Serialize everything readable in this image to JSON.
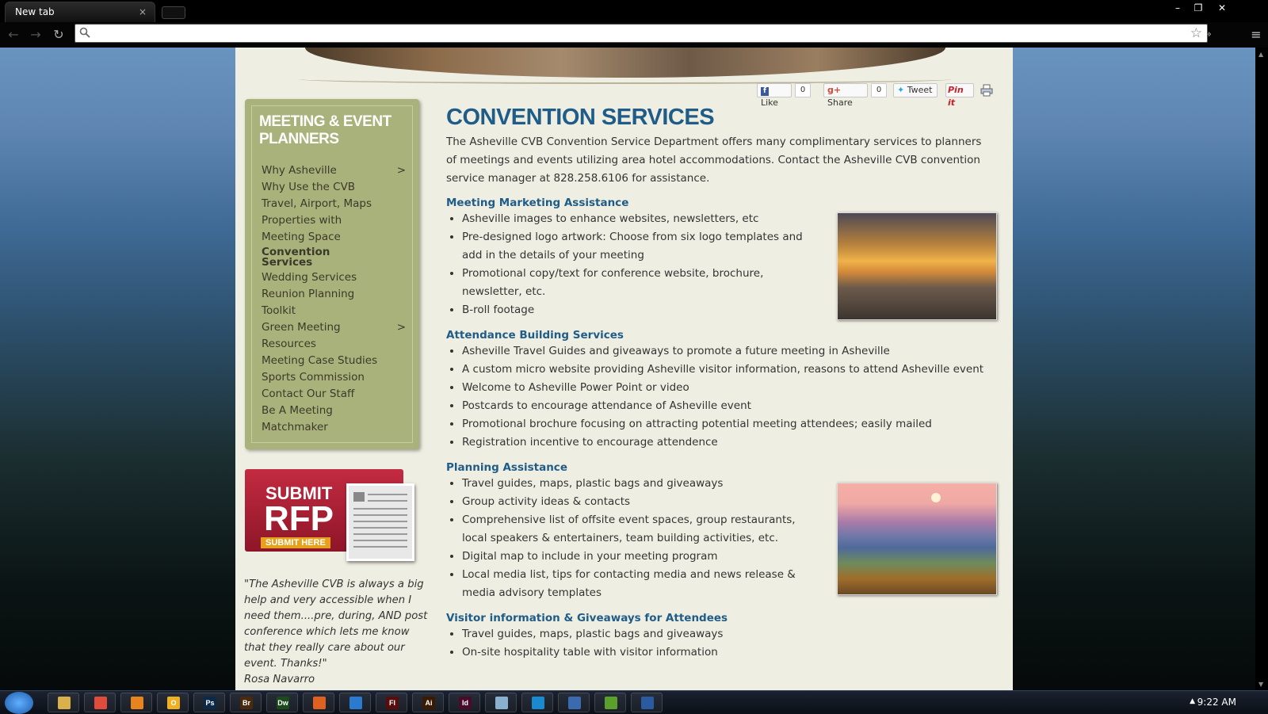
{
  "browser": {
    "tab_title": "New tab",
    "tab_close": "×",
    "address_value": "",
    "menu_glyph": "≡",
    "more_glyph": "»",
    "star_glyph": "☆",
    "win_min": "–",
    "win_max": "❐",
    "win_close": "✕"
  },
  "social": {
    "like_label": "Like",
    "like_count": "0",
    "share_label": "Share",
    "share_count": "0",
    "tweet_label": "Tweet",
    "pin_label": "Pin it"
  },
  "sidebar": {
    "title": "MEETING & EVENT PLANNERS",
    "items": [
      {
        "label": "Why Asheville",
        "arrow": ">"
      },
      {
        "label": "Why Use the CVB",
        "arrow": ""
      },
      {
        "label": "Travel, Airport, Maps",
        "arrow": ""
      },
      {
        "label": "Properties with Meeting Space",
        "arrow": ""
      },
      {
        "label": "Convention Services",
        "arrow": ""
      },
      {
        "label": "Wedding Services",
        "arrow": ""
      },
      {
        "label": "Reunion Planning",
        "arrow": ""
      },
      {
        "label": "Toolkit",
        "arrow": ""
      },
      {
        "label": "Green Meeting Resources",
        "arrow": ">"
      },
      {
        "label": "Meeting Case Studies",
        "arrow": ""
      },
      {
        "label": "Sports Commission",
        "arrow": ""
      },
      {
        "label": "Contact Our Staff",
        "arrow": ""
      },
      {
        "label": "Be A Meeting Matchmaker",
        "arrow": ""
      }
    ]
  },
  "rfp": {
    "submit": "SUBMIT",
    "rfp": "RFP",
    "submit_here": "SUBMIT HERE"
  },
  "testimonial": {
    "quote": "\"The Asheville CVB is always a big help and very accessible when I need them....pre, during, AND post conference which lets me know that they really care about our event. Thanks!\"",
    "author": "Rosa Navarro"
  },
  "main": {
    "title": "CONVENTION SERVICES",
    "intro": "The Asheville CVB Convention Service Department offers many complimentary services to planners of meetings and events utilizing area hotel accommodations. Contact the Asheville CVB convention service manager at 828.258.6106 for assistance.",
    "sections": [
      {
        "title": "Meeting Marketing Assistance",
        "items": [
          "Asheville images to enhance websites, newsletters, etc",
          "Pre-designed logo artwork: Choose from six logo templates and add in the details of your meeting",
          "Promotional copy/text for conference website, brochure, newsletter, etc.",
          "B-roll footage"
        ]
      },
      {
        "title": "Attendance Building Services",
        "items": [
          "Asheville Travel Guides and giveaways to promote a future meeting in Asheville",
          "A custom micro website providing Asheville visitor information, reasons to attend Asheville event",
          "Welcome to Asheville Power Point or video",
          "Postcards to encourage attendance of Asheville event",
          "Promotional brochure focusing on attracting potential meeting attendees; easily mailed",
          "Registration incentive to encourage attendence"
        ]
      },
      {
        "title": "Planning Assistance",
        "items": [
          "Travel guides, maps, plastic bags and giveaways",
          "Group activity ideas & contacts",
          "Comprehensive list of offsite event spaces, group restaurants, local speakers & entertainers, team building activities, etc.",
          "Digital map to include in your meeting program",
          "Local media list, tips for contacting media and news release & media advisory templates"
        ]
      },
      {
        "title": "Visitor information & Giveaways for Attendees",
        "items": [
          "Travel guides, maps, plastic bags and giveaways",
          "On-site hospitality table with visitor information"
        ]
      }
    ]
  },
  "taskbar": {
    "clock": "9:22 AM",
    "apps": [
      {
        "name": "explorer",
        "color": "#d9b04a",
        "glyph": ""
      },
      {
        "name": "chrome",
        "color": "#e04b3b",
        "glyph": ""
      },
      {
        "name": "firefox",
        "color": "#e8841e",
        "glyph": ""
      },
      {
        "name": "outlook",
        "color": "#f0b020",
        "glyph": "O"
      },
      {
        "name": "photoshop",
        "color": "#0b2a4a",
        "glyph": "Ps"
      },
      {
        "name": "bridge",
        "color": "#4a2a0b",
        "glyph": "Br"
      },
      {
        "name": "dreamweaver",
        "color": "#1b4a1b",
        "glyph": "Dw"
      },
      {
        "name": "app-shape",
        "color": "#e06020",
        "glyph": ""
      },
      {
        "name": "app-blue",
        "color": "#2a7ad0",
        "glyph": ""
      },
      {
        "name": "flash",
        "color": "#5a0b0b",
        "glyph": "Fl"
      },
      {
        "name": "illustrator",
        "color": "#3a1a00",
        "glyph": "Ai"
      },
      {
        "name": "indesign",
        "color": "#4a0b2a",
        "glyph": "Id"
      },
      {
        "name": "notepad",
        "color": "#8ab0d0",
        "glyph": ""
      },
      {
        "name": "skype",
        "color": "#1a8ad0",
        "glyph": ""
      },
      {
        "name": "itunes",
        "color": "#3a6ab0",
        "glyph": ""
      },
      {
        "name": "spotify",
        "color": "#5aa02a",
        "glyph": ""
      },
      {
        "name": "word",
        "color": "#2a5aa0",
        "glyph": ""
      }
    ]
  }
}
